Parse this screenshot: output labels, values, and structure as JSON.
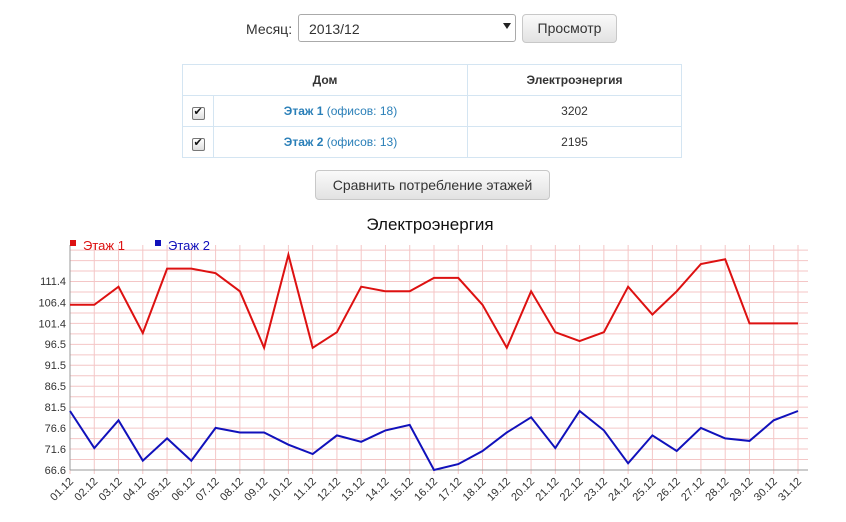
{
  "filter": {
    "month_label": "Месяц:",
    "month_value": "2013/12",
    "view_button": "Просмотр"
  },
  "table": {
    "headers": [
      "Дом",
      "Электроэнергия"
    ],
    "rows": [
      {
        "checked": true,
        "name": "Этаж 1",
        "offices": "(офисов: 18)",
        "value": "3202"
      },
      {
        "checked": true,
        "name": "Этаж 2",
        "offices": "(офисов: 13)",
        "value": "2195"
      }
    ]
  },
  "compare_button": "Сравнить потребление этажей",
  "chart_data": {
    "type": "line",
    "title": "Электроэнергия",
    "xlabel": "",
    "ylabel": "",
    "categories": [
      "01.12",
      "02.12",
      "03.12",
      "04.12",
      "05.12",
      "06.12",
      "07.12",
      "08.12",
      "09.12",
      "10.12",
      "11.12",
      "12.12",
      "13.12",
      "14.12",
      "15.12",
      "16.12",
      "17.12",
      "18.12",
      "19.12",
      "20.12",
      "21.12",
      "22.12",
      "23.12",
      "24.12",
      "25.12",
      "26.12",
      "27.12",
      "28.12",
      "29.12",
      "30.12",
      "31.12"
    ],
    "series": [
      {
        "name": "Этаж 1",
        "color": "#dd1111",
        "values": [
          105.8,
          105.8,
          110.1,
          99.1,
          114.4,
          114.4,
          113.3,
          109.0,
          95.6,
          117.7,
          95.6,
          99.3,
          110.1,
          109.0,
          109.0,
          112.2,
          112.2,
          105.8,
          95.6,
          109.0,
          99.3,
          97.2,
          99.3,
          110.1,
          103.5,
          109.0,
          115.5,
          116.6,
          101.4,
          101.4,
          101.4
        ]
      },
      {
        "name": "Этаж 2",
        "color": "#1111bb",
        "values": [
          80.6,
          71.8,
          78.4,
          68.8,
          74.1,
          68.8,
          76.6,
          75.5,
          75.5,
          72.6,
          70.4,
          74.8,
          73.3,
          76.0,
          77.3,
          66.6,
          68.0,
          71.1,
          75.5,
          79.1,
          71.8,
          80.6,
          76.0,
          68.2,
          74.8,
          71.1,
          76.6,
          74.1,
          73.5,
          78.4,
          80.6
        ]
      }
    ],
    "yticks": [
      "66.6",
      "71.6",
      "76.6",
      "81.5",
      "86.5",
      "91.5",
      "96.5",
      "101.4",
      "106.4",
      "111.4"
    ],
    "ylim": [
      66.6,
      120.0
    ],
    "grid": true,
    "legend": "top-left"
  }
}
